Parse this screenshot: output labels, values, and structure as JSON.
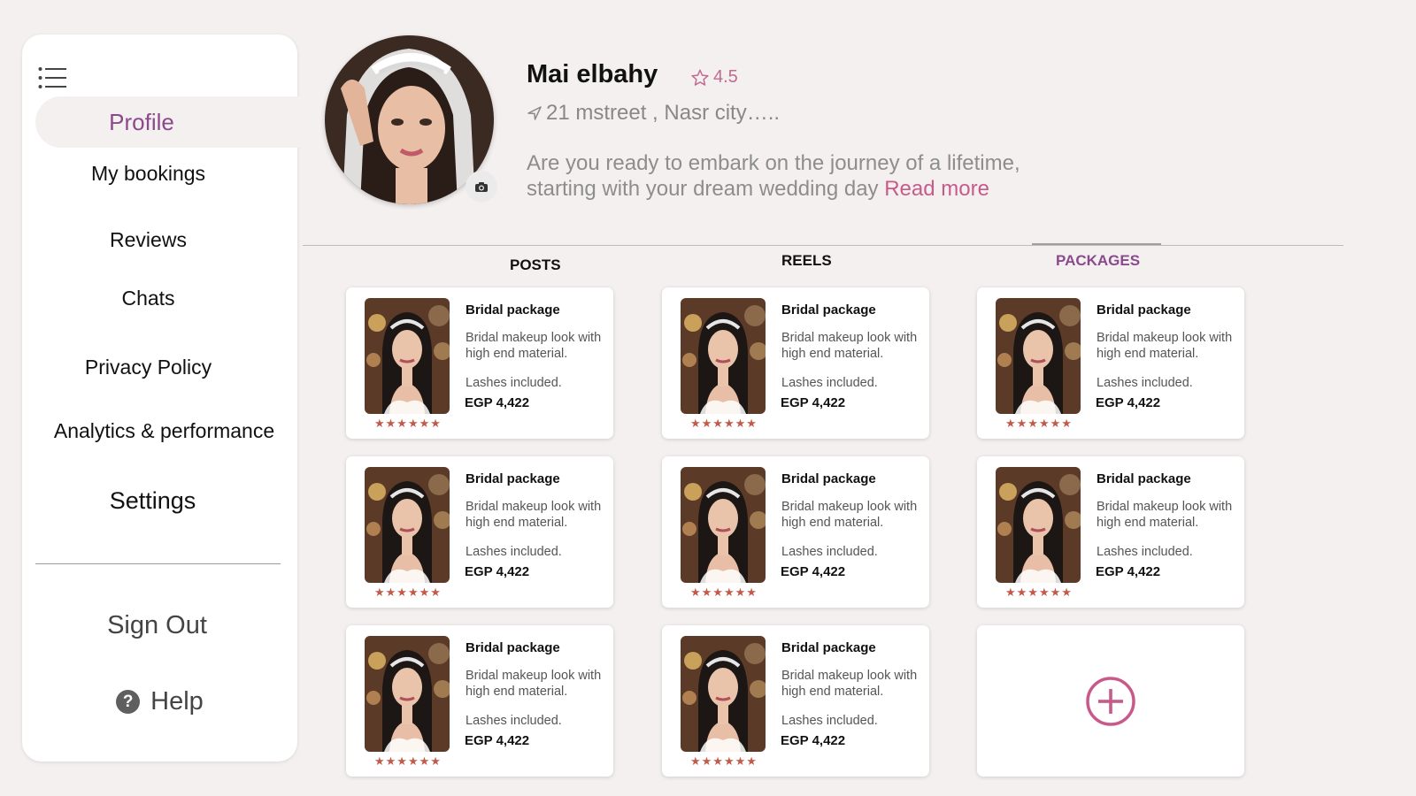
{
  "colors": {
    "accent": "#8a4a8c",
    "link": "#c85a8a",
    "rating": "#c26a90",
    "stars": "#c25a4a",
    "background": "#f4f0f0"
  },
  "sidebar": {
    "menu_icon": "list-menu-icon",
    "active_item": "Profile",
    "items": [
      {
        "label": "My bookings"
      },
      {
        "label": "Reviews"
      },
      {
        "label": "Chats"
      },
      {
        "label": "Privacy Policy"
      },
      {
        "label": "Analytics & performance"
      },
      {
        "label": "Settings"
      }
    ],
    "sign_out": "Sign Out",
    "help": "Help",
    "help_icon": "question-circle-icon"
  },
  "profile": {
    "name": "Mai elbahy",
    "rating": "4.5",
    "rating_icon": "star-outline-icon",
    "address": "21 mstreet , Nasr city…..",
    "address_icon": "location-arrow-icon",
    "bio_line1": "Are you ready to embark on the journey of a lifetime,",
    "bio_line2": "starting with your dream wedding day",
    "read_more": "Read more",
    "camera_icon": "camera-icon"
  },
  "tabs": [
    {
      "label": "POSTS"
    },
    {
      "label": "REELS"
    },
    {
      "label": "PACKAGES"
    }
  ],
  "active_tab": "PACKAGES",
  "cards": [
    {
      "title": "Bridal package",
      "desc": "Bridal makeup look with high end material.",
      "note": "Lashes included.",
      "price": "EGP 4,422",
      "stars": "★★★★★★"
    },
    {
      "title": "Bridal package",
      "desc": "Bridal makeup look with high end material.",
      "note": "Lashes included.",
      "price": "EGP 4,422",
      "stars": "★★★★★★"
    },
    {
      "title": "Bridal package",
      "desc": "Bridal makeup look with high end material.",
      "note": "Lashes included.",
      "price": "EGP 4,422",
      "stars": "★★★★★★"
    },
    {
      "title": "Bridal package",
      "desc": "Bridal makeup look with high end material.",
      "note": "Lashes included.",
      "price": "EGP 4,422",
      "stars": "★★★★★★"
    },
    {
      "title": "Bridal package",
      "desc": "Bridal makeup look with high end material.",
      "note": "Lashes included.",
      "price": "EGP 4,422",
      "stars": "★★★★★★"
    },
    {
      "title": "Bridal package",
      "desc": "Bridal makeup look with high end material.",
      "note": "Lashes included.",
      "price": "EGP 4,422",
      "stars": "★★★★★★"
    },
    {
      "title": "Bridal package",
      "desc": "Bridal makeup look with high end material.",
      "note": "Lashes included.",
      "price": "EGP 4,422",
      "stars": "★★★★★★"
    },
    {
      "title": "Bridal package",
      "desc": "Bridal makeup look with high end material.",
      "note": "Lashes included.",
      "price": "EGP 4,422",
      "stars": "★★★★★★"
    }
  ],
  "add_card_icon": "plus-circle-icon"
}
